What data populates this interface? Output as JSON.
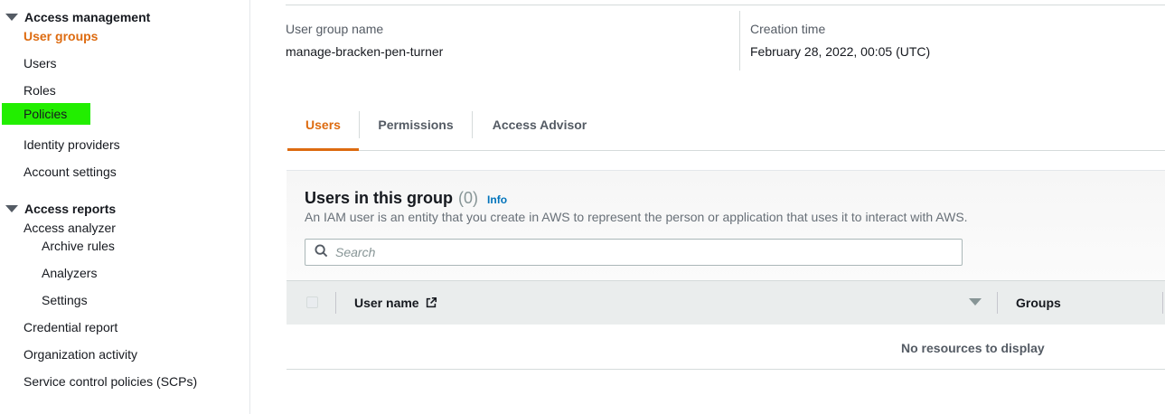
{
  "sidebar": {
    "access_management": {
      "heading": "Access management",
      "items": [
        {
          "label": "User groups"
        },
        {
          "label": "Users"
        },
        {
          "label": "Roles"
        },
        {
          "label": "Policies"
        },
        {
          "label": "Identity providers"
        },
        {
          "label": "Account settings"
        }
      ]
    },
    "access_reports": {
      "heading": "Access reports",
      "analyzer": "Access analyzer",
      "analyzer_sub": [
        {
          "label": "Archive rules"
        },
        {
          "label": "Analyzers"
        },
        {
          "label": "Settings"
        }
      ],
      "items": [
        {
          "label": "Credential report"
        },
        {
          "label": "Organization activity"
        },
        {
          "label": "Service control policies (SCPs)"
        }
      ]
    },
    "highlight_color": "#22ee00",
    "active_color": "#dd6b10"
  },
  "summary": {
    "group_name_label": "User group name",
    "group_name_value": "manage-bracken-pen-turner",
    "creation_time_label": "Creation time",
    "creation_time_value": "February 28, 2022, 00:05 (UTC)"
  },
  "tabs": [
    {
      "label": "Users"
    },
    {
      "label": "Permissions"
    },
    {
      "label": "Access Advisor"
    }
  ],
  "users_panel": {
    "title": "Users in this group",
    "count": "(0)",
    "info": "Info",
    "description": "An IAM user is an entity that you create in AWS to represent the person or application that uses it to interact with AWS.",
    "search_placeholder": "Search",
    "columns": {
      "user_name": "User name",
      "groups": "Groups"
    },
    "empty_message": "No resources to display"
  }
}
